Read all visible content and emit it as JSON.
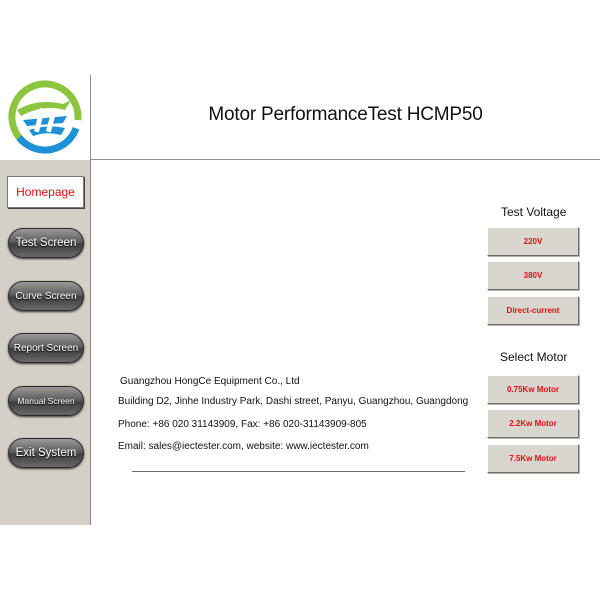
{
  "app": {
    "title": "Motor PerformanceTest HCMP50"
  },
  "sidebar": {
    "home_label": "Homepage",
    "items": [
      {
        "label": "Test Screen",
        "size": "11.5px"
      },
      {
        "label": "Curve Screen",
        "size": "10px"
      },
      {
        "label": "Report Screen",
        "size": "10px"
      },
      {
        "label": "Manual Screen",
        "size": "8.5px"
      },
      {
        "label": "Exit System",
        "size": "11.5px"
      }
    ]
  },
  "test_voltage": {
    "label": "Test Voltage",
    "options": [
      "220V",
      "380V",
      "Direct-current"
    ]
  },
  "select_motor": {
    "label": "Select Motor",
    "options": [
      "0.75Kw Motor",
      "2.2Kw Motor",
      "7.5Kw Motor"
    ]
  },
  "company": {
    "name": "Guangzhou HongCe Equipment Co., Ltd",
    "address": "Building D2, Jinhe Industry Park, Dashi street, Panyu, Guangzhou, Guangdong",
    "phone": "Phone: +86 020 31143909, Fax: +86 020-31143909-805",
    "email": "Email: sales@iectester.com, website: www.iectester.com"
  },
  "colors": {
    "accent_red": "#e01010",
    "logo_green": "#8cc63f",
    "logo_blue": "#1e90d6"
  }
}
